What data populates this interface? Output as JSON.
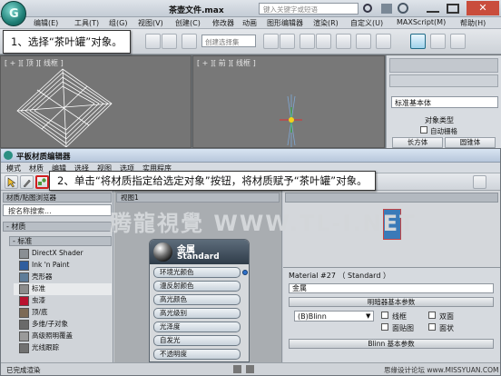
{
  "app": {
    "title": "茶壶文件.max",
    "search_placeholder": "键入关键字或短语",
    "logo_glyph": "G",
    "menu": [
      "编辑(E)",
      "工具(T)",
      "组(G)",
      "视图(V)",
      "创建(C)",
      "修改器",
      "动画",
      "图形编辑器",
      "渲染(R)",
      "自定义(U)",
      "MAXScript(M)",
      "帮助(H)"
    ],
    "selection_set_placeholder": "创建选择集",
    "viewports": {
      "left_label": "[ + ][ 顶 ][ 线框 ]",
      "mid_label": "[ + ][ 前 ][ 线框 ]"
    },
    "command_panel": {
      "dropdown": "标准基本体",
      "rollout_title": "对象类型",
      "autogrid": "自动栅格",
      "buttons": [
        "长方体",
        "圆锥体"
      ]
    }
  },
  "step1": "1、选择“茶叶罐”对象。",
  "step2": "2、单击“将材质指定给选定对象”按钮，将材质赋予“茶叶罐”对象。",
  "slate": {
    "title": "平板材质编辑器",
    "menu": [
      "模式",
      "材质",
      "编辑",
      "选择",
      "视图",
      "选项",
      "实用程序"
    ],
    "browser_title": "材质/贴图浏览器",
    "search_placeholder": "按名称搜索...",
    "group_material": "- 材质",
    "group_standard": "- 标准",
    "materials": [
      {
        "label": "DirectX Shader",
        "color": "#8a8f94"
      },
      {
        "label": "Ink 'n Paint",
        "color": "#2f5d9e"
      },
      {
        "label": "壳形器",
        "color": "#5f7d99"
      },
      {
        "label": "标准",
        "color": "#8c8c8c"
      },
      {
        "label": "虫漆",
        "color": "#b9122e"
      },
      {
        "label": "顶/底",
        "color": "#7d6a55"
      },
      {
        "label": "多维/子对象",
        "color": "#6a6a6a"
      },
      {
        "label": "高级照明覆盖",
        "color": "#9a9a9a"
      },
      {
        "label": "光线跟踪",
        "color": "#717171"
      }
    ],
    "node": {
      "title": "金属",
      "subtitle": "Standard",
      "slots": [
        "环境光颜色",
        "漫反射颜色",
        "高光颜色",
        "高光级别",
        "光泽度",
        "自发光",
        "不透明度"
      ]
    },
    "view_tab": "视图1",
    "watermark": "腾龍視覺 WWW.TL-I.NET",
    "params": {
      "header": "Material #27 （ Standard ）",
      "name_value": "金属",
      "shader_rollout": "明暗器基本参数",
      "shader_value": "(B)Blinn",
      "checkboxes": [
        "线框",
        "双面",
        "面贴图",
        "面状"
      ],
      "blinn_rollout": "Blinn 基本参数"
    },
    "status": "已完成渲染",
    "site": "思缘设计论坛 www.MISSYUAN.COM"
  }
}
